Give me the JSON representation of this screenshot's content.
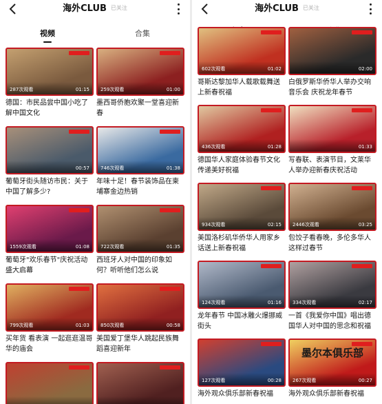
{
  "header": {
    "title": "海外CLUB",
    "follow_status": "已关注"
  },
  "tabs": [
    {
      "label": "视频"
    },
    {
      "label": "合集"
    }
  ],
  "left_videos": [
    {
      "caption": "德国：市民品尝中国小吃了解中国文化",
      "views": "287次观看",
      "duration": "01:15",
      "colors": [
        "#7a5a3e",
        "#c4a070"
      ]
    },
    {
      "caption": "墨西哥侨胞欢聚一堂喜迎新春",
      "views": "259次观看",
      "duration": "01:00",
      "colors": [
        "#8c2020",
        "#d8b080"
      ]
    },
    {
      "caption": "葡萄牙街头随访市民：关于中国了解多少?",
      "views": "",
      "duration": "00:57",
      "colors": [
        "#4a5a6a",
        "#a8907a"
      ]
    },
    {
      "caption": "年味十足！春节装饰品在柬埔寨金边热销",
      "views": "746次观看",
      "duration": "01:38",
      "colors": [
        "#3a6aa0",
        "#e8e8e8"
      ]
    },
    {
      "caption": "葡萄牙\"欢乐春节\"庆祝活动盛大启幕",
      "views": "1559次观看",
      "duration": "01:08",
      "colors": [
        "#6a1a4a",
        "#e04070"
      ]
    },
    {
      "caption": "西班牙人对中国的印象如何？听听他们怎么说",
      "views": "722次观看",
      "duration": "01:35",
      "colors": [
        "#5a4030",
        "#b09070"
      ]
    },
    {
      "caption": "买年货 看表演 一起逛逛温哥华的庙会",
      "views": "799次观看",
      "duration": "01:03",
      "colors": [
        "#a02a20",
        "#e0b060"
      ]
    },
    {
      "caption": "美国爱丁堡华人跳起民族舞蹈喜迎新年",
      "views": "850次观看",
      "duration": "00:58",
      "colors": [
        "#902020",
        "#e07040"
      ]
    },
    {
      "caption": "",
      "views": "",
      "duration": "",
      "colors": [
        "#8a6a40",
        "#c04030"
      ]
    },
    {
      "caption": "",
      "views": "",
      "duration": "",
      "colors": [
        "#502020",
        "#a06050"
      ]
    }
  ],
  "right_videos": [
    {
      "caption": "哥斯达黎加华人载歌载舞送上新春祝福",
      "views": "602次观看",
      "duration": "01:02",
      "colors": [
        "#c03020",
        "#e0c080"
      ]
    },
    {
      "caption": "白俄罗斯华侨华人举办交响音乐会 庆祝龙年春节",
      "views": "",
      "duration": "02:00",
      "colors": [
        "#2a2a2a",
        "#a06040"
      ]
    },
    {
      "caption": "德国华人家庭体验春节文化传递美好祝福",
      "views": "436次观看",
      "duration": "01:28",
      "colors": [
        "#b02020",
        "#e0c8a0"
      ]
    },
    {
      "caption": "写春联、表演节目，文莱华人举办迎新春庆祝活动",
      "views": "",
      "duration": "01:33",
      "colors": [
        "#b8202a",
        "#f0e0c0"
      ]
    },
    {
      "caption": "美国洛杉矶华侨华人用家乡话送上新春祝福",
      "views": "934次观看",
      "duration": "02:15",
      "colors": [
        "#5a4a3a",
        "#c0a888"
      ]
    },
    {
      "caption": "包饺子看春晚，多伦多华人这样过春节",
      "views": "2446次观看",
      "duration": "03:25",
      "colors": [
        "#6a4a30",
        "#d0b090"
      ]
    },
    {
      "caption": "龙年春节 中国冰雕火爆挪威街头",
      "views": "124次观看",
      "duration": "01:16",
      "colors": [
        "#4a5a70",
        "#b0b8c8"
      ]
    },
    {
      "caption": "一首《我爱你中国》唱出德国华人对中国的思念和祝福",
      "views": "334次观看",
      "duration": "02:17",
      "colors": [
        "#3a3a40",
        "#b0a0a0"
      ]
    },
    {
      "caption": "海外观众俱乐部新春祝福",
      "views": "127次观看",
      "duration": "00:28",
      "colors": [
        "#2a4a80",
        "#d04030"
      ]
    },
    {
      "caption": "海外观众俱乐部新春祝福",
      "views": "267次观看",
      "duration": "00:27",
      "colors": [
        "#c01a1a",
        "#f0d060"
      ],
      "overlay_text": "墨尔本俱乐部"
    }
  ]
}
